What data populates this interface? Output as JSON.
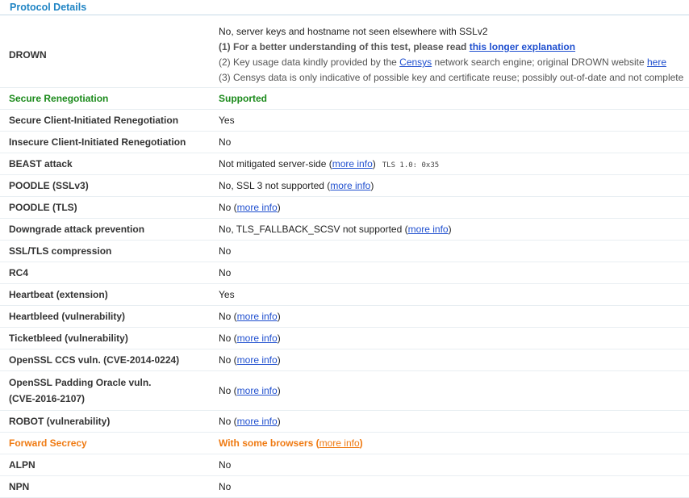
{
  "section": {
    "title": "Protocol Details"
  },
  "drown": {
    "label": "DROWN",
    "line1": "No, server keys and hostname not seen elsewhere with SSLv2",
    "line2_prefix": "(1) For a better understanding of this test, please read",
    "line2_link": "this longer explanation",
    "line3_prefix": "(2) Key usage data kindly provided by the",
    "line3_link1": "Censys",
    "line3_middle": "network search engine; original DROWN website",
    "line3_link2": "here",
    "line4": "(3) Censys data is only indicative of possible key and certificate reuse; possibly out-of-date and not complete"
  },
  "rows": {
    "secure_reneg": {
      "label": "Secure Renegotiation",
      "value": "Supported"
    },
    "client_reneg": {
      "label": "Secure Client-Initiated Renegotiation",
      "value": "Yes"
    },
    "insecure_reneg": {
      "label": "Insecure Client-Initiated Renegotiation",
      "value": "No"
    },
    "beast": {
      "label": "BEAST attack",
      "value_prefix": "Not mitigated server-side (",
      "link": "more info",
      "value_suffix": ")",
      "note": "TLS 1.0: 0x35"
    },
    "poodle_ssl": {
      "label": "POODLE (SSLv3)",
      "value_prefix": "No, SSL 3 not supported (",
      "link": "more info",
      "value_suffix": ")"
    },
    "poodle_tls": {
      "label": "POODLE (TLS)",
      "value_prefix": "No (",
      "link": "more info",
      "value_suffix": ")"
    },
    "downgrade": {
      "label": "Downgrade attack prevention",
      "value_prefix": "No, TLS_FALLBACK_SCSV not supported (",
      "link": "more info",
      "value_suffix": ")"
    },
    "compression": {
      "label": "SSL/TLS compression",
      "value": "No"
    },
    "rc4": {
      "label": "RC4",
      "value": "No"
    },
    "heartbeat": {
      "label": "Heartbeat (extension)",
      "value": "Yes"
    },
    "heartbleed": {
      "label": "Heartbleed (vulnerability)",
      "value_prefix": "No (",
      "link": "more info",
      "value_suffix": ")"
    },
    "ticketbleed": {
      "label": "Ticketbleed (vulnerability)",
      "value_prefix": "No (",
      "link": "more info",
      "value_suffix": ")"
    },
    "ccs": {
      "label": "OpenSSL CCS vuln. (CVE-2014-0224)",
      "value_prefix": "No (",
      "link": "more info",
      "value_suffix": ")"
    },
    "padding": {
      "label_line1": "OpenSSL Padding Oracle vuln.",
      "label_line2": "(CVE-2016-2107)",
      "value_prefix": "No (",
      "link": "more info",
      "value_suffix": ")"
    },
    "robot": {
      "label": "ROBOT (vulnerability)",
      "value_prefix": "No (",
      "link": "more info",
      "value_suffix": ")"
    },
    "forward": {
      "label": "Forward Secrecy",
      "value_prefix": "With some browsers",
      "link": "more info"
    },
    "alpn": {
      "label": "ALPN",
      "value": "No"
    },
    "npn": {
      "label": "NPN",
      "value": "No"
    }
  },
  "colors": {
    "header": "#1f84c4",
    "good": "#1b8a1b",
    "warn": "#ef7a12",
    "link": "#1f4fcf"
  }
}
